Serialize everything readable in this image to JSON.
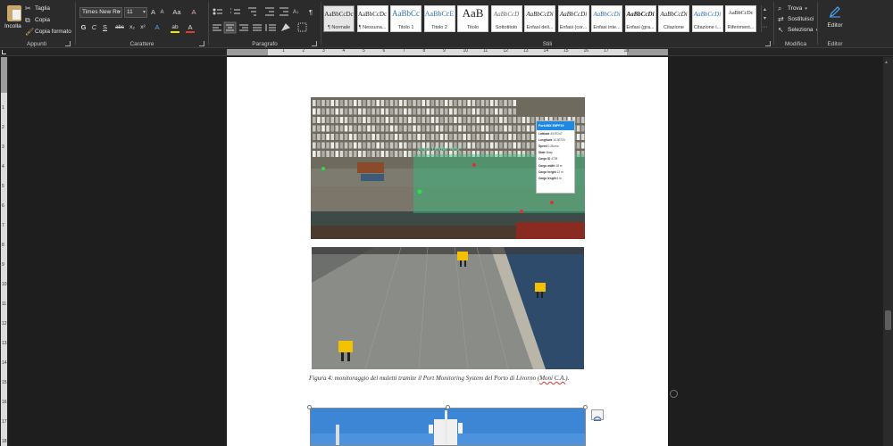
{
  "ribbon": {
    "clipboard": {
      "paste_label": "Incolla",
      "cut_label": "Taglia",
      "copy_label": "Copia",
      "format_painter_label": "Copia formato",
      "group_label": "Appunti"
    },
    "font": {
      "family": "Times New Rc",
      "size": "11",
      "grow_label": "A",
      "shrink_label": "A",
      "case_label": "Aa",
      "clear_format_label": "A",
      "bold": "G",
      "italic": "C",
      "underline": "S",
      "strikethrough": "abc",
      "subscript": "x₂",
      "superscript": "x²",
      "text_effects": "A",
      "highlight": "ab",
      "font_color": "A",
      "group_label": "Carattere",
      "highlight_color": "#f5e400",
      "font_color_value": "#e03c31"
    },
    "paragraph": {
      "show_marks": "¶",
      "group_label": "Paragrafo"
    },
    "styles": {
      "tiles": [
        {
          "preview": "AaBbCcDc",
          "name": "¶ Normale",
          "active": true
        },
        {
          "preview": "AaBbCcDc",
          "name": "¶ Nessuna..."
        },
        {
          "preview": "AaBbCc",
          "name": "Titolo 1"
        },
        {
          "preview": "AaBbCcE",
          "name": "Titolo 2"
        },
        {
          "preview": "AaB",
          "name": "Titolo"
        },
        {
          "preview": "AaBbCcD",
          "name": "Sottotitolo"
        },
        {
          "preview": "AaBbCcDi",
          "name": "Enfasi deli..."
        },
        {
          "preview": "AaBbCcDi",
          "name": "Enfasi (cor..."
        },
        {
          "preview": "AaBbCcDi",
          "name": "Enfasi inte..."
        },
        {
          "preview": "AaBbCcDi",
          "name": "Enfasi (gra..."
        },
        {
          "preview": "AaBbCcDi",
          "name": "Citazione"
        },
        {
          "preview": "AaBbCcDi",
          "name": "Citazione i..."
        },
        {
          "preview": "AaBbCcDc",
          "name": "Riferiment..."
        }
      ],
      "group_label": "Stili"
    },
    "editing": {
      "find_label": "Trova",
      "replace_label": "Sostituisci",
      "select_label": "Seleziona",
      "group_label": "Modifica"
    },
    "editor": {
      "button_label": "Editor",
      "group_label": "Editor"
    }
  },
  "rulers": {
    "top_numbers": [
      "1",
      "2",
      "3",
      "4",
      "5",
      "6",
      "7",
      "8",
      "9",
      "10",
      "11",
      "12",
      "13",
      "14",
      "15",
      "16",
      "17",
      "18"
    ],
    "left_numbers": [
      "1",
      "2",
      "3",
      "4",
      "5",
      "6",
      "7",
      "8",
      "9",
      "10",
      "11",
      "12",
      "13",
      "14",
      "15",
      "16",
      "17",
      "18"
    ]
  },
  "document": {
    "map_overlay": {
      "area_label": "Area Under Test",
      "popup_title": "ForkliftX E8PF19",
      "popup_rows": [
        {
          "label": "Latitude",
          "value": "43.57247"
        },
        {
          "label": "Longitude",
          "value": "10.30720"
        },
        {
          "label": "Speed",
          "value": "0.28 m/s"
        },
        {
          "label": "State",
          "value": "Busy"
        },
        {
          "label": "Cargo ID",
          "value": "4728"
        },
        {
          "label": "Cargo width",
          "value": "18 m"
        },
        {
          "label": "Cargo height",
          "value": "12 m"
        },
        {
          "label": "Cargo length",
          "value": "6 m"
        }
      ]
    },
    "caption_main": "Figura 4: monitoraggio dei muletti tramite il Port Monitoring System del Porto di Livorno (",
    "caption_mark": "Moni C.A.",
    "caption_end": ")."
  }
}
